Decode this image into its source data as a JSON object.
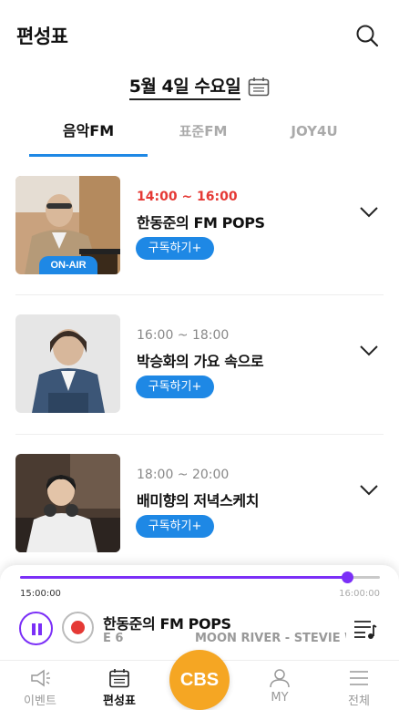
{
  "header": {
    "title": "편성표",
    "search_icon": "search-icon"
  },
  "date": {
    "label": "5월 4일 수요일",
    "icon": "calendar-icon"
  },
  "tabs": [
    {
      "label": "음악FM",
      "active": true
    },
    {
      "label": "표준FM",
      "active": false
    },
    {
      "label": "JOY4U",
      "active": false
    }
  ],
  "programs": [
    {
      "time": "14:00 ~ 16:00",
      "name": "한동준의 FM POPS",
      "subscribe": "구독하기+",
      "badge": "ON-AIR",
      "live": true
    },
    {
      "time": "16:00 ~ 18:00",
      "name": "박승화의 가요 속으로",
      "subscribe": "구독하기+",
      "live": false
    },
    {
      "time": "18:00 ~ 20:00",
      "name": "배미향의 저녁스케치",
      "subscribe": "구독하기+",
      "live": false
    }
  ],
  "player": {
    "start_time": "15:00:00",
    "end_time": "16:00:00",
    "progress": 0.91,
    "title": "한동준의 FM POPS",
    "episode_fragment": "E 6",
    "song": "MOON RIVER - STEVIE WONDER"
  },
  "colors": {
    "accent_blue": "#1e88e5",
    "accent_purple": "#7b2ff7",
    "live_red": "#e53935",
    "cbs_orange": "#f5a623"
  },
  "nav": [
    {
      "label": "이벤트",
      "icon": "megaphone-icon",
      "active": false
    },
    {
      "label": "편성표",
      "icon": "calendar-icon",
      "active": true
    },
    {
      "label": "CBS",
      "icon": "cbs-logo",
      "active": false
    },
    {
      "label": "MY",
      "icon": "person-icon",
      "active": false
    },
    {
      "label": "전체",
      "icon": "menu-icon",
      "active": false
    }
  ]
}
